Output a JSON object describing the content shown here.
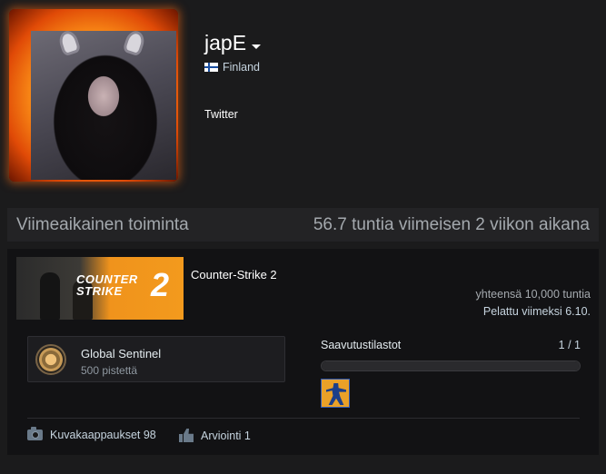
{
  "profile": {
    "username": "japE",
    "country": "Finland",
    "link": "Twitter"
  },
  "activity": {
    "title": "Viimeaikainen toiminta",
    "hours_summary": "56.7 tuntia viimeisen 2 viikon aikana"
  },
  "game": {
    "name": "Counter-Strike 2",
    "banner_text_line1": "COUNTER",
    "banner_text_line2": "STRIKE",
    "banner_number": "2",
    "total_playtime": "yhteensä 10,000 tuntia",
    "last_played": "Pelattu viimeksi 6.10.",
    "badge": {
      "name": "Global Sentinel",
      "points": "500 pistettä",
      "icon": "medal-icon"
    },
    "achievements": {
      "label": "Saavutustilastot",
      "count": "1 / 1",
      "progress": 1.0,
      "icon": "counter-terrorist-icon"
    },
    "stats": {
      "screenshots": "Kuvakaappaukset 98",
      "reviews": "Arviointi 1"
    }
  },
  "colors": {
    "background": "#1b1b1c",
    "panel": "#121214",
    "accent": "#f5a623"
  }
}
